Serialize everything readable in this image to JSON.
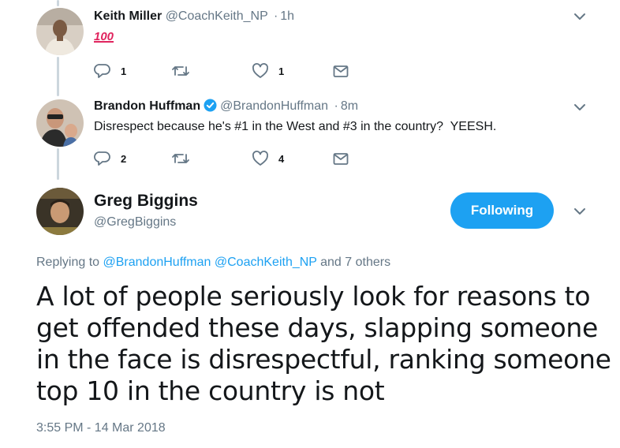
{
  "reply1": {
    "name": "Keith Miller",
    "handle": "@CoachKeith_NP",
    "time": "1h",
    "text": "100",
    "actions": {
      "reply_count": "1",
      "retweet_count": "",
      "like_count": "1"
    }
  },
  "reply2": {
    "name": "Brandon Huffman",
    "handle": "@BrandonHuffman",
    "time": "8m",
    "text": "Disrespect because he's #1 in the West and #3 in the country?  YEESH.",
    "actions": {
      "reply_count": "2",
      "retweet_count": "",
      "like_count": "4"
    }
  },
  "main": {
    "name": "Greg Biggins",
    "handle": "@GregBiggins",
    "follow_label": "Following",
    "replying": {
      "prefix": "Replying to",
      "mention1": "@BrandonHuffman",
      "mention2": "@CoachKeith_NP",
      "suffix": "and 7 others"
    },
    "text_lines": [
      "A lot of people seriously look for reasons to",
      "get offended these days, slapping someone",
      "in the face is disrespectful, ranking someone",
      "top 10 in the country is not"
    ],
    "timestamp": "3:55 PM - 14 Mar 2018"
  },
  "colors": {
    "accent": "#1da1f2",
    "secondary_text": "#657786",
    "primary_text": "#14171a",
    "thread_line": "#ccd6dd"
  },
  "icons": [
    "reply-icon",
    "retweet-icon",
    "like-icon",
    "dm-icon",
    "caret-down-icon",
    "verified-icon"
  ]
}
